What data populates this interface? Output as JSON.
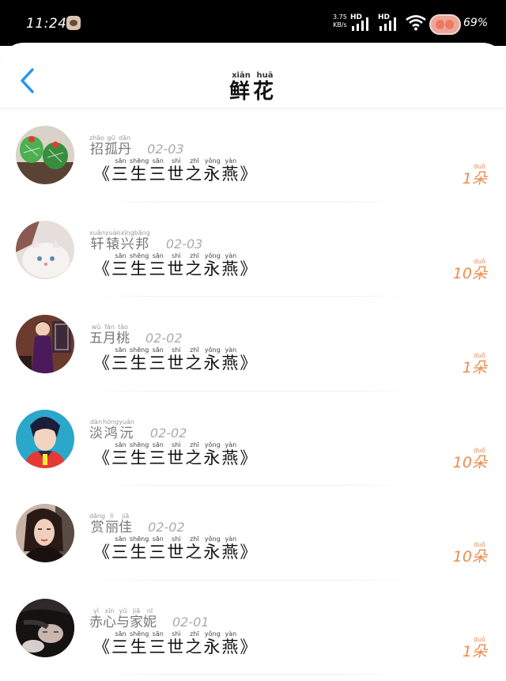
{
  "status_bar": {
    "time": "11:24",
    "net_speed_value": "3.75",
    "net_speed_unit": "KB/s",
    "hd_label_1": "HD",
    "hd_label_2": "HD",
    "battery_percent": "69%"
  },
  "header": {
    "title": [
      {
        "char": "鲜",
        "pinyin": "xiān"
      },
      {
        "char": "花",
        "pinyin": "huā"
      }
    ],
    "back_icon": "chevron-left-icon"
  },
  "colors": {
    "accent": "#2196f3",
    "count_orange": "#f08a4b",
    "name_gray": "#777777",
    "date_gray": "#aaaaaa"
  },
  "gift_records": [
    {
      "name": [
        {
          "char": "招",
          "pinyin": "zhāo"
        },
        {
          "char": "孤",
          "pinyin": "gū"
        },
        {
          "char": "丹",
          "pinyin": "dān"
        }
      ],
      "date": "02-03",
      "gift": [
        {
          "char": "《",
          "pinyin": ""
        },
        {
          "char": "三",
          "pinyin": "sān"
        },
        {
          "char": "生",
          "pinyin": "shēng"
        },
        {
          "char": "三",
          "pinyin": "sān"
        },
        {
          "char": "世",
          "pinyin": "shì"
        },
        {
          "char": "之",
          "pinyin": "zhī"
        },
        {
          "char": "永",
          "pinyin": "yǒng"
        },
        {
          "char": "燕",
          "pinyin": "yàn"
        },
        {
          "char": "》",
          "pinyin": ""
        }
      ],
      "count_number": "1",
      "count_unit": {
        "char": "朵",
        "pinyin": "duǒ"
      },
      "avatar": "avatar-cactus"
    },
    {
      "name": [
        {
          "char": "轩",
          "pinyin": "xuān"
        },
        {
          "char": "辕",
          "pinyin": "yuán"
        },
        {
          "char": "兴",
          "pinyin": "xīng"
        },
        {
          "char": "邦",
          "pinyin": "bāng"
        }
      ],
      "date": "02-03",
      "gift": [
        {
          "char": "《",
          "pinyin": ""
        },
        {
          "char": "三",
          "pinyin": "sān"
        },
        {
          "char": "生",
          "pinyin": "shēng"
        },
        {
          "char": "三",
          "pinyin": "sān"
        },
        {
          "char": "世",
          "pinyin": "shì"
        },
        {
          "char": "之",
          "pinyin": "zhī"
        },
        {
          "char": "永",
          "pinyin": "yǒng"
        },
        {
          "char": "燕",
          "pinyin": "yàn"
        },
        {
          "char": "》",
          "pinyin": ""
        }
      ],
      "count_number": "10",
      "count_unit": {
        "char": "朵",
        "pinyin": "duǒ"
      },
      "avatar": "avatar-cat"
    },
    {
      "name": [
        {
          "char": "五",
          "pinyin": "wǔ"
        },
        {
          "char": "月",
          "pinyin": "fán"
        },
        {
          "char": "桃",
          "pinyin": "táo"
        }
      ],
      "date": "02-02",
      "gift": [
        {
          "char": "《",
          "pinyin": ""
        },
        {
          "char": "三",
          "pinyin": "sān"
        },
        {
          "char": "生",
          "pinyin": "shēng"
        },
        {
          "char": "三",
          "pinyin": "sān"
        },
        {
          "char": "世",
          "pinyin": "shì"
        },
        {
          "char": "之",
          "pinyin": "zhī"
        },
        {
          "char": "永",
          "pinyin": "yǒng"
        },
        {
          "char": "燕",
          "pinyin": "yàn"
        },
        {
          "char": "》",
          "pinyin": ""
        }
      ],
      "count_number": "1",
      "count_unit": {
        "char": "朵",
        "pinyin": "duǒ"
      },
      "avatar": "avatar-woman-qipao"
    },
    {
      "name": [
        {
          "char": "淡",
          "pinyin": "dàn"
        },
        {
          "char": "鸿",
          "pinyin": "hóng"
        },
        {
          "char": "沅",
          "pinyin": "yuán"
        }
      ],
      "date": "02-02",
      "gift": [
        {
          "char": "《",
          "pinyin": ""
        },
        {
          "char": "三",
          "pinyin": "sān"
        },
        {
          "char": "生",
          "pinyin": "shēng"
        },
        {
          "char": "三",
          "pinyin": "sān"
        },
        {
          "char": "世",
          "pinyin": "shì"
        },
        {
          "char": "之",
          "pinyin": "zhī"
        },
        {
          "char": "永",
          "pinyin": "yǒng"
        },
        {
          "char": "燕",
          "pinyin": "yàn"
        },
        {
          "char": "》",
          "pinyin": ""
        }
      ],
      "count_number": "10",
      "count_unit": {
        "char": "朵",
        "pinyin": "duǒ"
      },
      "avatar": "avatar-anime-man"
    },
    {
      "name": [
        {
          "char": "赏",
          "pinyin": "dǎng"
        },
        {
          "char": "丽",
          "pinyin": "lì"
        },
        {
          "char": "佳",
          "pinyin": "jiā"
        }
      ],
      "date": "02-02",
      "gift": [
        {
          "char": "《",
          "pinyin": ""
        },
        {
          "char": "三",
          "pinyin": "sān"
        },
        {
          "char": "生",
          "pinyin": "shēng"
        },
        {
          "char": "三",
          "pinyin": "sān"
        },
        {
          "char": "世",
          "pinyin": "shì"
        },
        {
          "char": "之",
          "pinyin": "zhī"
        },
        {
          "char": "永",
          "pinyin": "yǒng"
        },
        {
          "char": "燕",
          "pinyin": "yàn"
        },
        {
          "char": "》",
          "pinyin": ""
        }
      ],
      "count_number": "10",
      "count_unit": {
        "char": "朵",
        "pinyin": "duǒ"
      },
      "avatar": "avatar-woman-portrait"
    },
    {
      "name": [
        {
          "char": "赤",
          "pinyin": "yì"
        },
        {
          "char": "心",
          "pinyin": "xīn"
        },
        {
          "char": "与",
          "pinyin": "yǔ"
        },
        {
          "char": "家",
          "pinyin": "jiā"
        },
        {
          "char": "妮",
          "pinyin": "nī"
        }
      ],
      "date": "02-01",
      "gift": [
        {
          "char": "《",
          "pinyin": ""
        },
        {
          "char": "三",
          "pinyin": "sān"
        },
        {
          "char": "生",
          "pinyin": "shēng"
        },
        {
          "char": "三",
          "pinyin": "sān"
        },
        {
          "char": "世",
          "pinyin": "shì"
        },
        {
          "char": "之",
          "pinyin": "zhī"
        },
        {
          "char": "永",
          "pinyin": "yǒng"
        },
        {
          "char": "燕",
          "pinyin": "yàn"
        },
        {
          "char": "》",
          "pinyin": ""
        }
      ],
      "count_number": "1",
      "count_unit": {
        "char": "朵",
        "pinyin": "duǒ"
      },
      "avatar": "avatar-dark-hair"
    }
  ]
}
